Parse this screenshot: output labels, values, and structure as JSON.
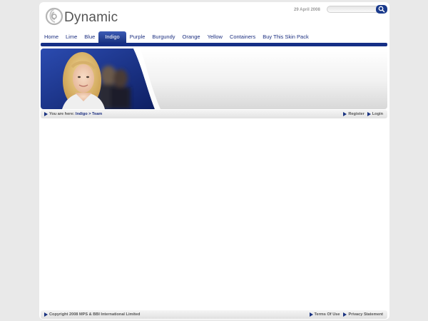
{
  "header": {
    "logo_text": "Dynamic",
    "date": "29 April 2008",
    "search": {
      "value": "",
      "placeholder": ""
    }
  },
  "nav": {
    "items": [
      {
        "label": "Home",
        "active": false
      },
      {
        "label": "Lime",
        "active": false
      },
      {
        "label": "Blue",
        "active": false
      },
      {
        "label": "Indigo",
        "active": true
      },
      {
        "label": "Purple",
        "active": false
      },
      {
        "label": "Burgundy",
        "active": false
      },
      {
        "label": "Orange",
        "active": false
      },
      {
        "label": "Yellow",
        "active": false
      },
      {
        "label": "Containers",
        "active": false
      },
      {
        "label": "Buy This Skin Pack",
        "active": false
      }
    ]
  },
  "breadcrumb": {
    "prefix": "You are here:",
    "path": "Indigo > Team",
    "register": "Register",
    "login": "Login"
  },
  "footer": {
    "copyright": "Copyright 2008 MPS & BBI International Limited",
    "terms": "Terms Of Use",
    "privacy": "Privacy Statement"
  },
  "colors": {
    "accent": "#1a3381",
    "nav_text": "#1c2f80",
    "page_bg": "#e9e9e9"
  },
  "icons": {
    "logo": "swirl-logo-icon",
    "search": "search-magnifier-icon",
    "arrow": "arrow-right-icon"
  }
}
